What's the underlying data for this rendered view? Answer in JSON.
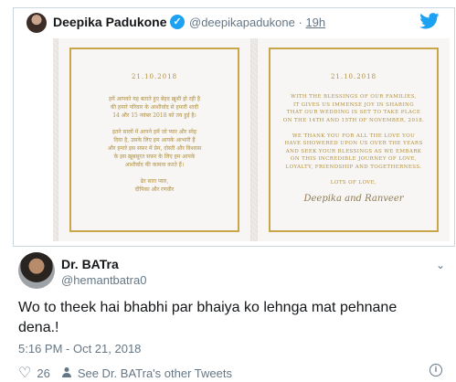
{
  "quoted_tweet": {
    "author_name": "Deepika Padukone",
    "handle": "@deepikapadukone",
    "separator": "·",
    "time_ago": "19h",
    "verified_glyph": "✓",
    "bird_icon": "twitter-bird-icon",
    "image": {
      "left_card": {
        "date": "21.10.2018",
        "lines": [
          "हमें आपको यह बताते हुए बेहद ख़ुशी हो रही है",
          "की हमारे परिवार के आशीर्वाद से हमारी शादी",
          "14 और 15 नवंबर 2018 को तय हुई है।",
          "",
          "इतने सालों में आपने हमें जो प्यार और स्नेह",
          "दिया है, उसके लिए हम आपके आभारी हैं",
          "और हमारे इस सफ़र में प्रेम, दोस्ती और विश्वास",
          "के इस ख़ूबसूरत सफ़र के लिए हम आपके",
          "आशीर्वाद की कामना करते हैं।",
          "",
          "ढेर सारा प्यार,",
          "दीपिका और रणवीर"
        ]
      },
      "right_card": {
        "date": "21.10.2018",
        "lines": [
          "WITH THE BLESSINGS OF OUR FAMILIES,",
          "IT GIVES US IMMENSE JOY IN SHARING",
          "THAT OUR WEDDING IS SET TO TAKE PLACE",
          "ON THE 14TH AND 15TH OF NOVEMBER, 2018.",
          "",
          "WE THANK YOU FOR ALL THE LOVE YOU",
          "HAVE SHOWERED UPON US OVER THE YEARS",
          "AND SEEK YOUR BLESSINGS AS WE EMBARK",
          "ON THIS INCREDIBLE JOURNEY OF LOVE,",
          "LOYALTY, FRIENDSHIP AND TOGETHERNESS.",
          "",
          "LOTS OF LOVE,"
        ],
        "signature": "Deepika and Ranveer"
      }
    }
  },
  "tweet": {
    "author_name": "Dr. BATra",
    "handle": "@hemantbatra0",
    "text": "Wo to theek hai bhabhi par bhaiya ko lehnga mat pehnane dena.!",
    "timestamp": "5:16 PM - Oct 21, 2018",
    "likes": "26",
    "other_tweets_link": "See Dr. BATra's other Tweets",
    "heart_glyph": "♡",
    "person_glyph": "👤",
    "info_glyph": "i",
    "chevron_glyph": "⌄"
  },
  "colors": {
    "twitter_blue": "#1da1f2",
    "gold": "#c9a64a",
    "muted": "#657786"
  }
}
